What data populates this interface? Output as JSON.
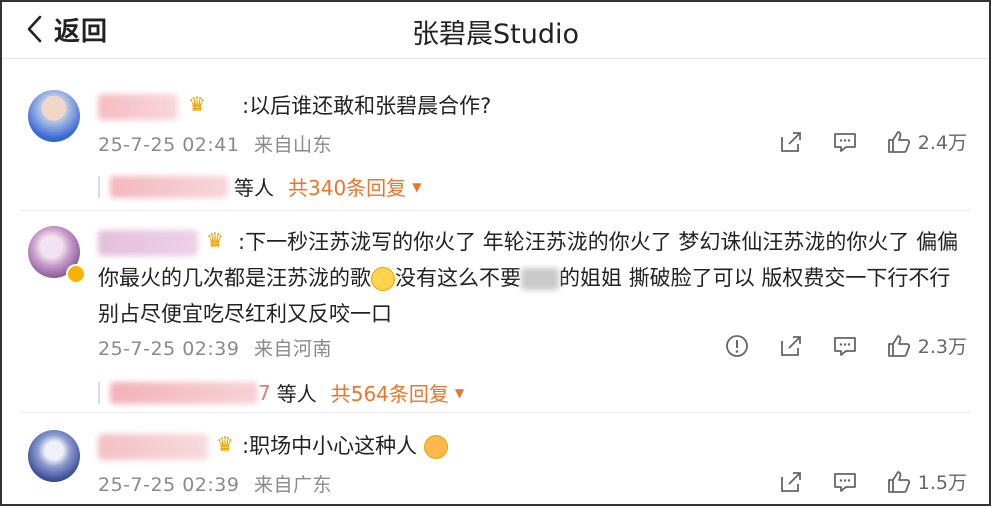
{
  "header": {
    "back_label": "返回",
    "title": "张碧晨Studio"
  },
  "comments": [
    {
      "text": ":以后谁还敢和张碧晨合作?",
      "time": "25-7-25 02:41",
      "location": "来自山东",
      "likes": "2.4万",
      "reply_tail": "等人",
      "reply_count": "共340条回复"
    },
    {
      "text_part1": ":下一秒汪苏泷写的你火了 年轮汪苏泷的你火了 梦幻诛仙汪苏泷的你火了 偏偏你最火的几次都是汪苏泷的歌",
      "text_part2": "没有这么不要",
      "text_part3": "的姐姐 撕破脸了可以 版权费交一下行不行 别占尽便宜吃尽红利又反咬一口",
      "time": "25-7-25 02:39",
      "location": "来自河南",
      "likes": "2.3万",
      "reply_tail_num": "7",
      "reply_tail": "等人",
      "reply_count": "共564条回复"
    },
    {
      "text": ":职场中小心这种人",
      "time": "25-7-25 02:39",
      "location": "来自广东",
      "likes": "1.5万"
    }
  ],
  "colors": {
    "accent": "#e8762c",
    "meta": "#8a8a8a",
    "crown": "#e6a000"
  },
  "icons": [
    "back-chevron-icon",
    "crown-icon",
    "share-icon",
    "comment-icon",
    "like-icon",
    "report-icon",
    "caret-down-icon"
  ]
}
